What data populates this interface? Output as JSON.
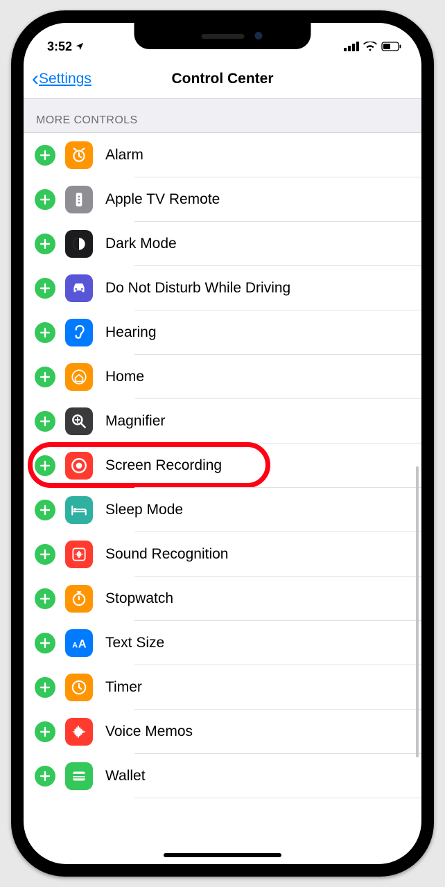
{
  "status": {
    "time": "3:52"
  },
  "nav": {
    "back": "Settings",
    "title": "Control Center"
  },
  "section": {
    "header": "MORE CONTROLS"
  },
  "items": [
    {
      "label": "Alarm",
      "icon": "alarm",
      "bg": "bg-orange"
    },
    {
      "label": "Apple TV Remote",
      "icon": "remote",
      "bg": "bg-gray"
    },
    {
      "label": "Dark Mode",
      "icon": "darkmode",
      "bg": "bg-black"
    },
    {
      "label": "Do Not Disturb While Driving",
      "icon": "car",
      "bg": "bg-indigo"
    },
    {
      "label": "Hearing",
      "icon": "ear",
      "bg": "bg-blue"
    },
    {
      "label": "Home",
      "icon": "home",
      "bg": "bg-orange"
    },
    {
      "label": "Magnifier",
      "icon": "magnifier",
      "bg": "bg-darkgray"
    },
    {
      "label": "Screen Recording",
      "icon": "record",
      "bg": "bg-red",
      "highlighted": true
    },
    {
      "label": "Sleep Mode",
      "icon": "bed",
      "bg": "bg-teal"
    },
    {
      "label": "Sound Recognition",
      "icon": "sound",
      "bg": "bg-red"
    },
    {
      "label": "Stopwatch",
      "icon": "stopwatch",
      "bg": "bg-orange"
    },
    {
      "label": "Text Size",
      "icon": "textsize",
      "bg": "bg-blue"
    },
    {
      "label": "Timer",
      "icon": "timer",
      "bg": "bg-orange"
    },
    {
      "label": "Voice Memos",
      "icon": "voice",
      "bg": "bg-red"
    },
    {
      "label": "Wallet",
      "icon": "wallet",
      "bg": "bg-green"
    }
  ]
}
